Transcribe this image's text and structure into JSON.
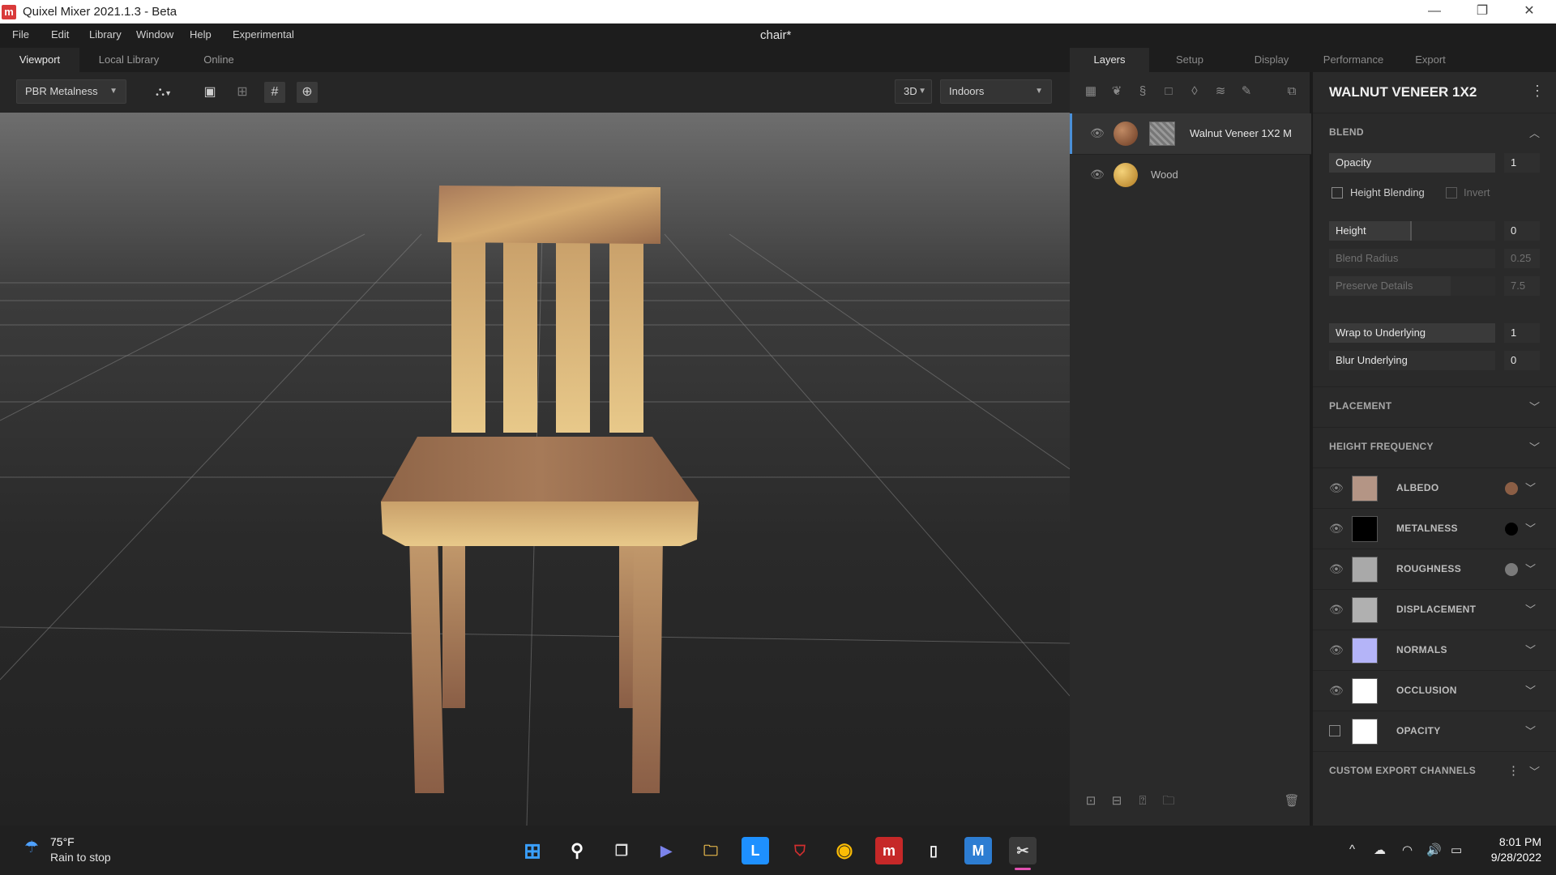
{
  "window": {
    "app_title": "Quixel Mixer 2021.1.3 - Beta",
    "document_title": "chair*",
    "logo_letter": "m",
    "controls": [
      "—",
      "❐",
      "✕"
    ]
  },
  "menu": [
    "File",
    "Edit",
    "Library",
    "Window",
    "Help",
    "Experimental"
  ],
  "left_tabs": [
    "Viewport",
    "Local Library",
    "Online"
  ],
  "toolbar": {
    "render_mode": "PBR Metalness",
    "view_mode": "3D",
    "environment": "Indoors"
  },
  "right_tabs": [
    "Layers",
    "Setup",
    "Display",
    "Performance",
    "Export"
  ],
  "layers": [
    {
      "name": "Walnut Veneer 1X2 M",
      "selected": true,
      "ball_color": "#8a5634"
    },
    {
      "name": "Wood",
      "selected": false,
      "ball_color": "#d9a53a"
    }
  ],
  "properties": {
    "material_title": "WALNUT VENEER 1X2",
    "blend": {
      "header": "BLEND",
      "opacity_label": "Opacity",
      "opacity_value": "1",
      "height_blending_label": "Height Blending",
      "invert_label": "Invert",
      "height_label": "Height",
      "height_value": "0",
      "blend_radius_label": "Blend Radius",
      "blend_radius_value": "0.25",
      "preserve_details_label": "Preserve Details",
      "preserve_details_value": "7.5",
      "wrap_label": "Wrap to Underlying",
      "wrap_value": "1",
      "blur_label": "Blur Underlying",
      "blur_value": "0"
    },
    "placement_header": "PLACEMENT",
    "height_frequency_header": "HEIGHT FREQUENCY",
    "channels": [
      {
        "name": "ALBEDO",
        "swatch": "#b49585",
        "dot": "#8b5e45",
        "visible": true
      },
      {
        "name": "METALNESS",
        "swatch": "#000000",
        "dot": "#000000",
        "visible": true
      },
      {
        "name": "ROUGHNESS",
        "swatch": "#a9a9a9",
        "dot": "#7a7a7a",
        "visible": true
      },
      {
        "name": "DISPLACEMENT",
        "swatch": "#b0b0b0",
        "dot": "",
        "visible": true
      },
      {
        "name": "NORMALS",
        "swatch": "#b4b4f8",
        "dot": "",
        "visible": true
      },
      {
        "name": "OCCLUSION",
        "swatch": "#ffffff",
        "dot": "",
        "visible": true
      },
      {
        "name": "OPACITY",
        "swatch": "#ffffff",
        "dot": "",
        "visible": false
      }
    ],
    "custom_export_header": "CUSTOM EXPORT CHANNELS"
  },
  "taskbar": {
    "weather_temp": "75°F",
    "weather_desc": "Rain to stop",
    "time": "8:01 PM",
    "date": "9/28/2022",
    "apps": [
      "start",
      "search",
      "task-view",
      "meet",
      "file-explorer",
      "L",
      "mcafee",
      "chrome",
      "mixer",
      "notepad",
      "M",
      "snipping"
    ]
  },
  "colors": {
    "accent": "#4a90d9",
    "panel": "#2a2a2a",
    "background": "#1b1b1b"
  }
}
